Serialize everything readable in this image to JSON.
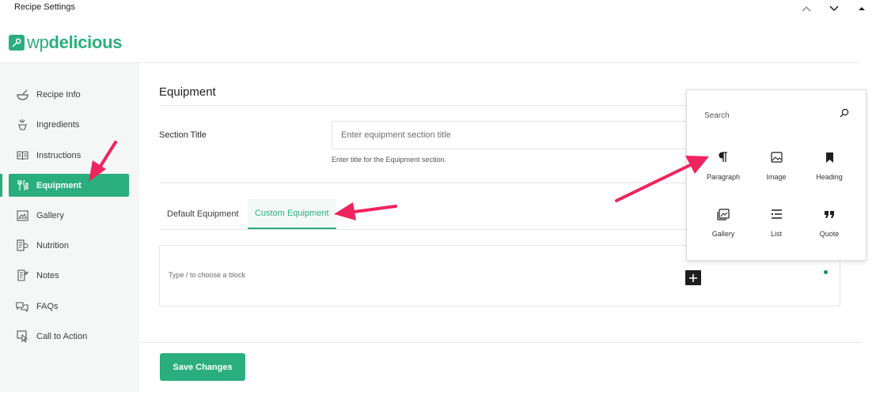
{
  "window": {
    "title": "Recipe Settings",
    "collapse_icon": "chevron-up-icon",
    "expand_icon": "chevron-down-icon"
  },
  "logo": {
    "text_light": "wp",
    "text_bold": "delicious",
    "color": "#2bae7f"
  },
  "sidebar": {
    "items": [
      {
        "label": "Recipe Info",
        "icon": "bowl-icon"
      },
      {
        "label": "Ingredients",
        "icon": "ingredients-icon"
      },
      {
        "label": "Instructions",
        "icon": "book-icon"
      },
      {
        "label": "Equipment",
        "icon": "utensils-icon",
        "active": true
      },
      {
        "label": "Gallery",
        "icon": "gallery-icon"
      },
      {
        "label": "Nutrition",
        "icon": "nutrition-icon"
      },
      {
        "label": "Notes",
        "icon": "notes-icon"
      },
      {
        "label": "FAQs",
        "icon": "faq-icon"
      },
      {
        "label": "Call to Action",
        "icon": "cursor-icon"
      }
    ]
  },
  "main": {
    "title": "Equipment",
    "section_title_label": "Section Title",
    "section_title_placeholder": "Enter equipment section title",
    "section_title_value": "",
    "section_title_help": "Enter title for the Equipment section.",
    "tabs": [
      {
        "label": "Default Equipment",
        "active": false
      },
      {
        "label": "Custom Equipment",
        "active": true
      }
    ],
    "editor_placeholder": "Type / to choose a block",
    "save_label": "Save Changes"
  },
  "inserter": {
    "search_placeholder": "Search",
    "blocks": [
      {
        "label": "Paragraph",
        "icon": "paragraph-icon"
      },
      {
        "label": "Image",
        "icon": "image-icon"
      },
      {
        "label": "Heading",
        "icon": "bookmark-icon"
      },
      {
        "label": "Gallery",
        "icon": "gallery-icon"
      },
      {
        "label": "List",
        "icon": "list-icon"
      },
      {
        "label": "Quote",
        "icon": "quote-icon"
      }
    ]
  },
  "colors": {
    "accent": "#2bae7f",
    "annotation_arrow": "#f0245f"
  }
}
